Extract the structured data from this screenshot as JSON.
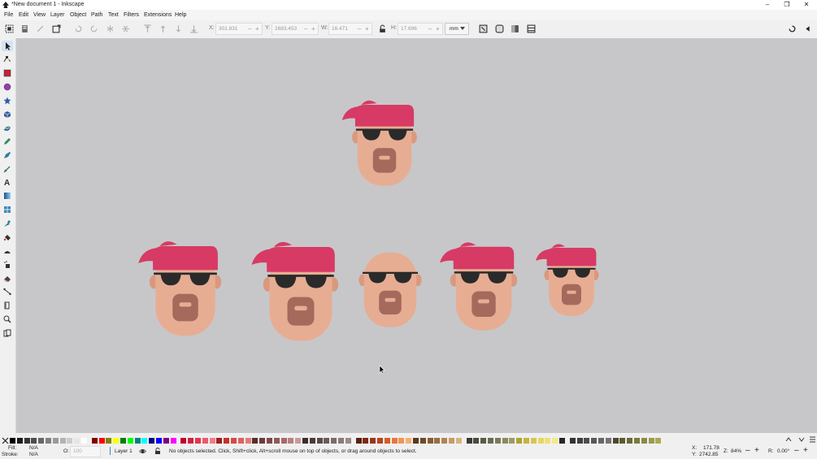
{
  "window": {
    "title": "*New document 1 - Inkscape",
    "controls": [
      "–",
      "❐",
      "✕"
    ]
  },
  "menu": [
    "File",
    "Edit",
    "View",
    "Layer",
    "Object",
    "Path",
    "Text",
    "Filters",
    "Extensions",
    "Help"
  ],
  "toolbar": {
    "x_label": "X:",
    "x_value": "301.831",
    "y_label": "Y:",
    "y_value": "2683.453",
    "w_label": "W:",
    "w_value": "16.471",
    "h_label": "H:",
    "h_value": "17.696",
    "unit": "mm",
    "minus": "–",
    "plus": "+"
  },
  "colors": {
    "bandana": "#d73a64",
    "skin": "#e7ad93",
    "skin_ear": "#d9997f",
    "beard": "#a66a5c",
    "glasses": "#2a2a2a",
    "canvas": "#c7c7c9"
  },
  "palette": [
    "#000000",
    "#1a1a1a",
    "#333333",
    "#4d4d4d",
    "#666666",
    "#808080",
    "#999999",
    "#b3b3b3",
    "#cccccc",
    "#e6e6e6",
    "#ffffff",
    "#800000",
    "#ff0000",
    "#808000",
    "#ffff00",
    "#008000",
    "#00ff00",
    "#008080",
    "#00ffff",
    "#000080",
    "#0000ff",
    "#800080",
    "#ff00ff",
    "#c3002c",
    "#d4203f",
    "#e1374f",
    "#ea5a6b",
    "#f07d88",
    "#a01e1e",
    "#c43030",
    "#d84848",
    "#e06060",
    "#e87878",
    "#5a2d2d",
    "#6d3b3b",
    "#804848",
    "#935858",
    "#a66a6a",
    "#b88080",
    "#cc9999",
    "#3d2c2c",
    "#4a3a3a",
    "#5a4a4a",
    "#6a5a5a",
    "#7a6a6a",
    "#8a7a7a",
    "#9a8a8a",
    "#5c1f0f",
    "#7a2a13",
    "#993617",
    "#b8451e",
    "#d65a2a",
    "#e6773d",
    "#f09455",
    "#f5b070",
    "#5a3a20",
    "#6e4a2a",
    "#855c36",
    "#9b6e44",
    "#b08454",
    "#c49c68",
    "#d6b480",
    "#3a3a3a",
    "#4a4a40",
    "#5a5a48",
    "#6a6a50",
    "#7a7a58",
    "#8a8a60",
    "#9a9a68",
    "#b0a030",
    "#c4b440",
    "#d6c650",
    "#e6d660",
    "#eee070",
    "#f4ea88",
    "#262626",
    "#333333",
    "#404040",
    "#4d4d4d",
    "#595959",
    "#666666",
    "#737373",
    "#4a4a2a",
    "#5a5a30",
    "#6a6a38",
    "#7a7a40",
    "#8a8a48",
    "#9a9a50",
    "#aaaa58"
  ],
  "status": {
    "fill_label": "Fill:",
    "fill_value": "N/A",
    "stroke_label": "Stroke:",
    "stroke_value": "N/A",
    "opacity_label": "O:",
    "opacity_value": "100",
    "layer": "Layer 1",
    "message": "No objects selected. Click, Shift+click, Alt+scroll mouse on top of objects, or drag around objects to select.",
    "cursor_x_label": "X:",
    "cursor_x": "171.78",
    "cursor_y_label": "Y:",
    "cursor_y": "2742.85",
    "zoom_label": "Z:",
    "zoom": "84%",
    "rotation_label": "R:",
    "rotation": "0.00°"
  }
}
